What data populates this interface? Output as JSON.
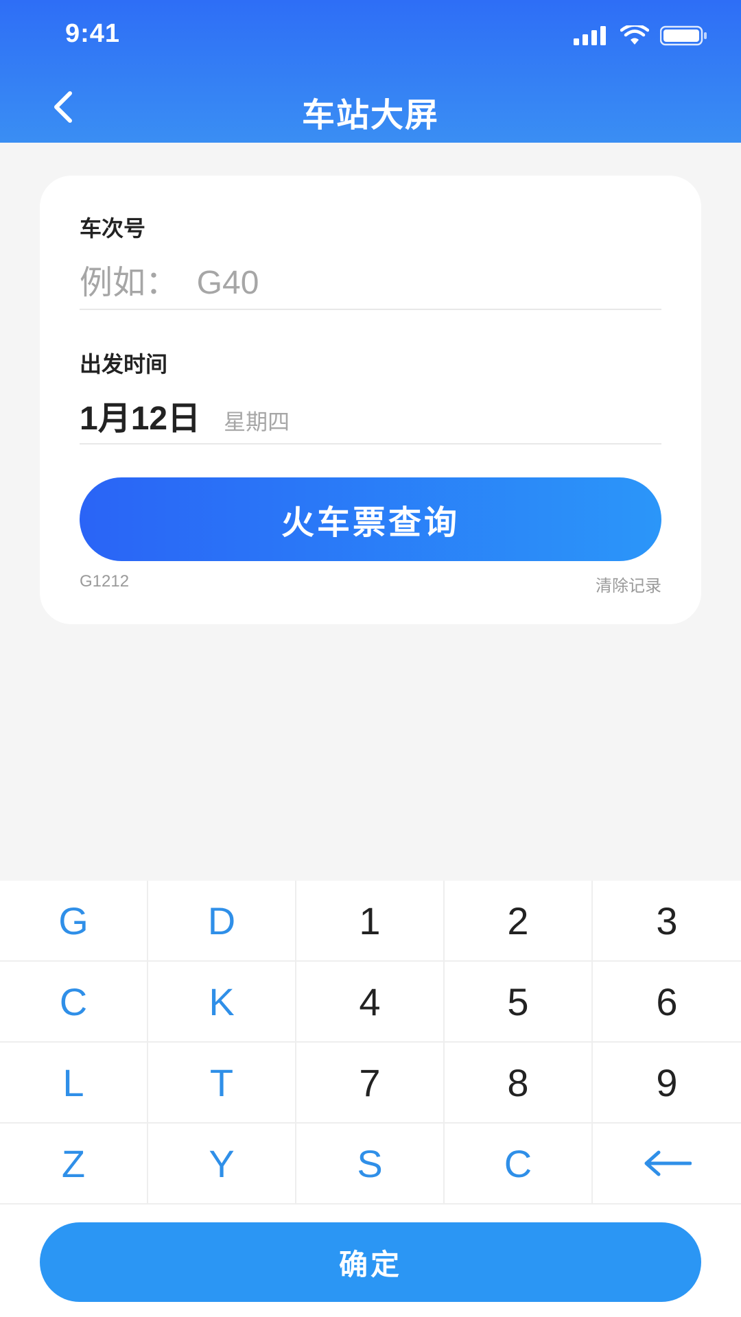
{
  "status_bar": {
    "time": "9:41",
    "icons": [
      "signal-icon",
      "wifi-icon",
      "battery-icon"
    ]
  },
  "nav": {
    "title": "车站大屏",
    "back_icon": "chevron-left-icon"
  },
  "form": {
    "train_number": {
      "label": "车次号",
      "placeholder": "例如：  G40",
      "value": ""
    },
    "departure": {
      "label": "出发时间",
      "date": "1月12日",
      "weekday": "星期四"
    },
    "query_button": "火车票查询",
    "history": [
      "G1212"
    ],
    "clear_history": "清除记录"
  },
  "keyboard": {
    "keys": [
      {
        "label": "G",
        "style": "blue"
      },
      {
        "label": "D",
        "style": "blue"
      },
      {
        "label": "1",
        "style": "dark"
      },
      {
        "label": "2",
        "style": "dark"
      },
      {
        "label": "3",
        "style": "dark"
      },
      {
        "label": "C",
        "style": "blue"
      },
      {
        "label": "K",
        "style": "blue"
      },
      {
        "label": "4",
        "style": "dark"
      },
      {
        "label": "5",
        "style": "dark"
      },
      {
        "label": "6",
        "style": "dark"
      },
      {
        "label": "L",
        "style": "blue"
      },
      {
        "label": "T",
        "style": "blue"
      },
      {
        "label": "7",
        "style": "dark"
      },
      {
        "label": "8",
        "style": "dark"
      },
      {
        "label": "9",
        "style": "dark"
      },
      {
        "label": "Z",
        "style": "blue"
      },
      {
        "label": "Y",
        "style": "blue"
      },
      {
        "label": "S",
        "style": "blue"
      },
      {
        "label": "C",
        "style": "blue"
      },
      {
        "label": "←",
        "style": "blue",
        "icon": "backspace-arrow-icon"
      }
    ],
    "confirm_label": "确定"
  },
  "colors": {
    "header_top": "#2e6ef6",
    "header_bottom": "#3a8ef3",
    "key_letter": "#2f8fe8",
    "key_digit": "#222222",
    "confirm_button": "#2b96f4",
    "background": "#f5f5f5"
  }
}
